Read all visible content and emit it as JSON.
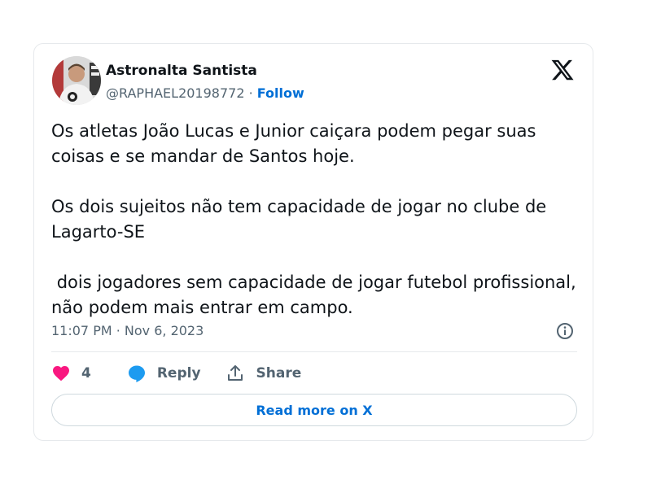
{
  "tweet": {
    "author_name": "Astronalta Santista",
    "handle": "@RAPHAEL20198772",
    "separator": " · ",
    "follow_label": "Follow",
    "text": "Os atletas João Lucas e Junior caiçara podem pegar suas coisas e se mandar de Santos hoje.\n\nOs dois sujeitos não tem capacidade de jogar no clube de Lagarto-SE\n\n dois jogadores sem capacidade de jogar futebol profissional, não podem mais entrar em campo.",
    "timestamp": "11:07 PM · Nov 6, 2023"
  },
  "actions": {
    "like_count": "4",
    "reply_label": "Reply",
    "share_label": "Share"
  },
  "read_more_label": "Read more on X",
  "icons": {
    "brand": "x-logo-icon",
    "info": "info-icon",
    "like": "heart-icon",
    "reply": "speech-bubble-icon",
    "share": "share-upload-icon"
  },
  "colors": {
    "text": "#0f1419",
    "muted": "#536471",
    "link": "#006fd6",
    "heart": "#f91880",
    "reply_bubble": "#1d9bf0",
    "border": "#e6e9ec"
  }
}
